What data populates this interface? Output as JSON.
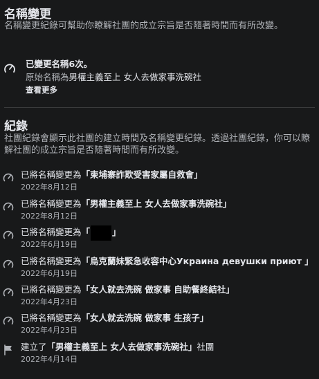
{
  "rename_section": {
    "title": "名稱變更",
    "description": "名稱變更紀錄可幫助你瞭解社團的成立宗旨是否隨著時間而有所改變。",
    "summary": "已變更名稱6次。",
    "original_name_prefix": "原始名稱為",
    "original_name": "男權主義至上 女人去做家事洗碗社",
    "see_more": "查看更多"
  },
  "history_section": {
    "title": "紀錄",
    "description": "社團紀錄會顯示此社團的建立時間及名稱變更紀錄。透過社團紀錄，你可以瞭解社團的成立宗旨是否隨著時間而有所改變。",
    "entries": [
      {
        "icon": "rename-icon",
        "prefix": "已將名稱變更為",
        "name": "「柬埔寨詐欺受害家屬自救會」",
        "suffix": "",
        "date": "2022年8月12日"
      },
      {
        "icon": "rename-icon",
        "prefix": "已將名稱變更為",
        "name": "「男權主義至上 女人去做家事洗碗社」",
        "suffix": "",
        "date": "2022年8月12日"
      },
      {
        "icon": "rename-icon",
        "prefix": "已將名稱變更為",
        "name": "「」",
        "suffix": "",
        "date": "2022年6月19日",
        "redacted": true
      },
      {
        "icon": "rename-icon",
        "prefix": "已將名稱變更為",
        "name": "「烏克蘭妹緊急收容中心Украина девушки приют 」",
        "suffix": "",
        "date": "2022年6月19日"
      },
      {
        "icon": "rename-icon",
        "prefix": "已將名稱變更為",
        "name": "「女人就去洗碗 做家事 自助餐終結社」",
        "suffix": "",
        "date": "2022年4月23日"
      },
      {
        "icon": "rename-icon",
        "prefix": "已將名稱變更為",
        "name": "「女人就去洗碗 做家事 生孩子」",
        "suffix": "",
        "date": "2022年4月23日"
      },
      {
        "icon": "flag-icon",
        "prefix": "建立了",
        "name": "「男權主義至上 女人去做家事洗碗社」",
        "suffix": "社團",
        "date": "2022年4月14日"
      }
    ]
  }
}
